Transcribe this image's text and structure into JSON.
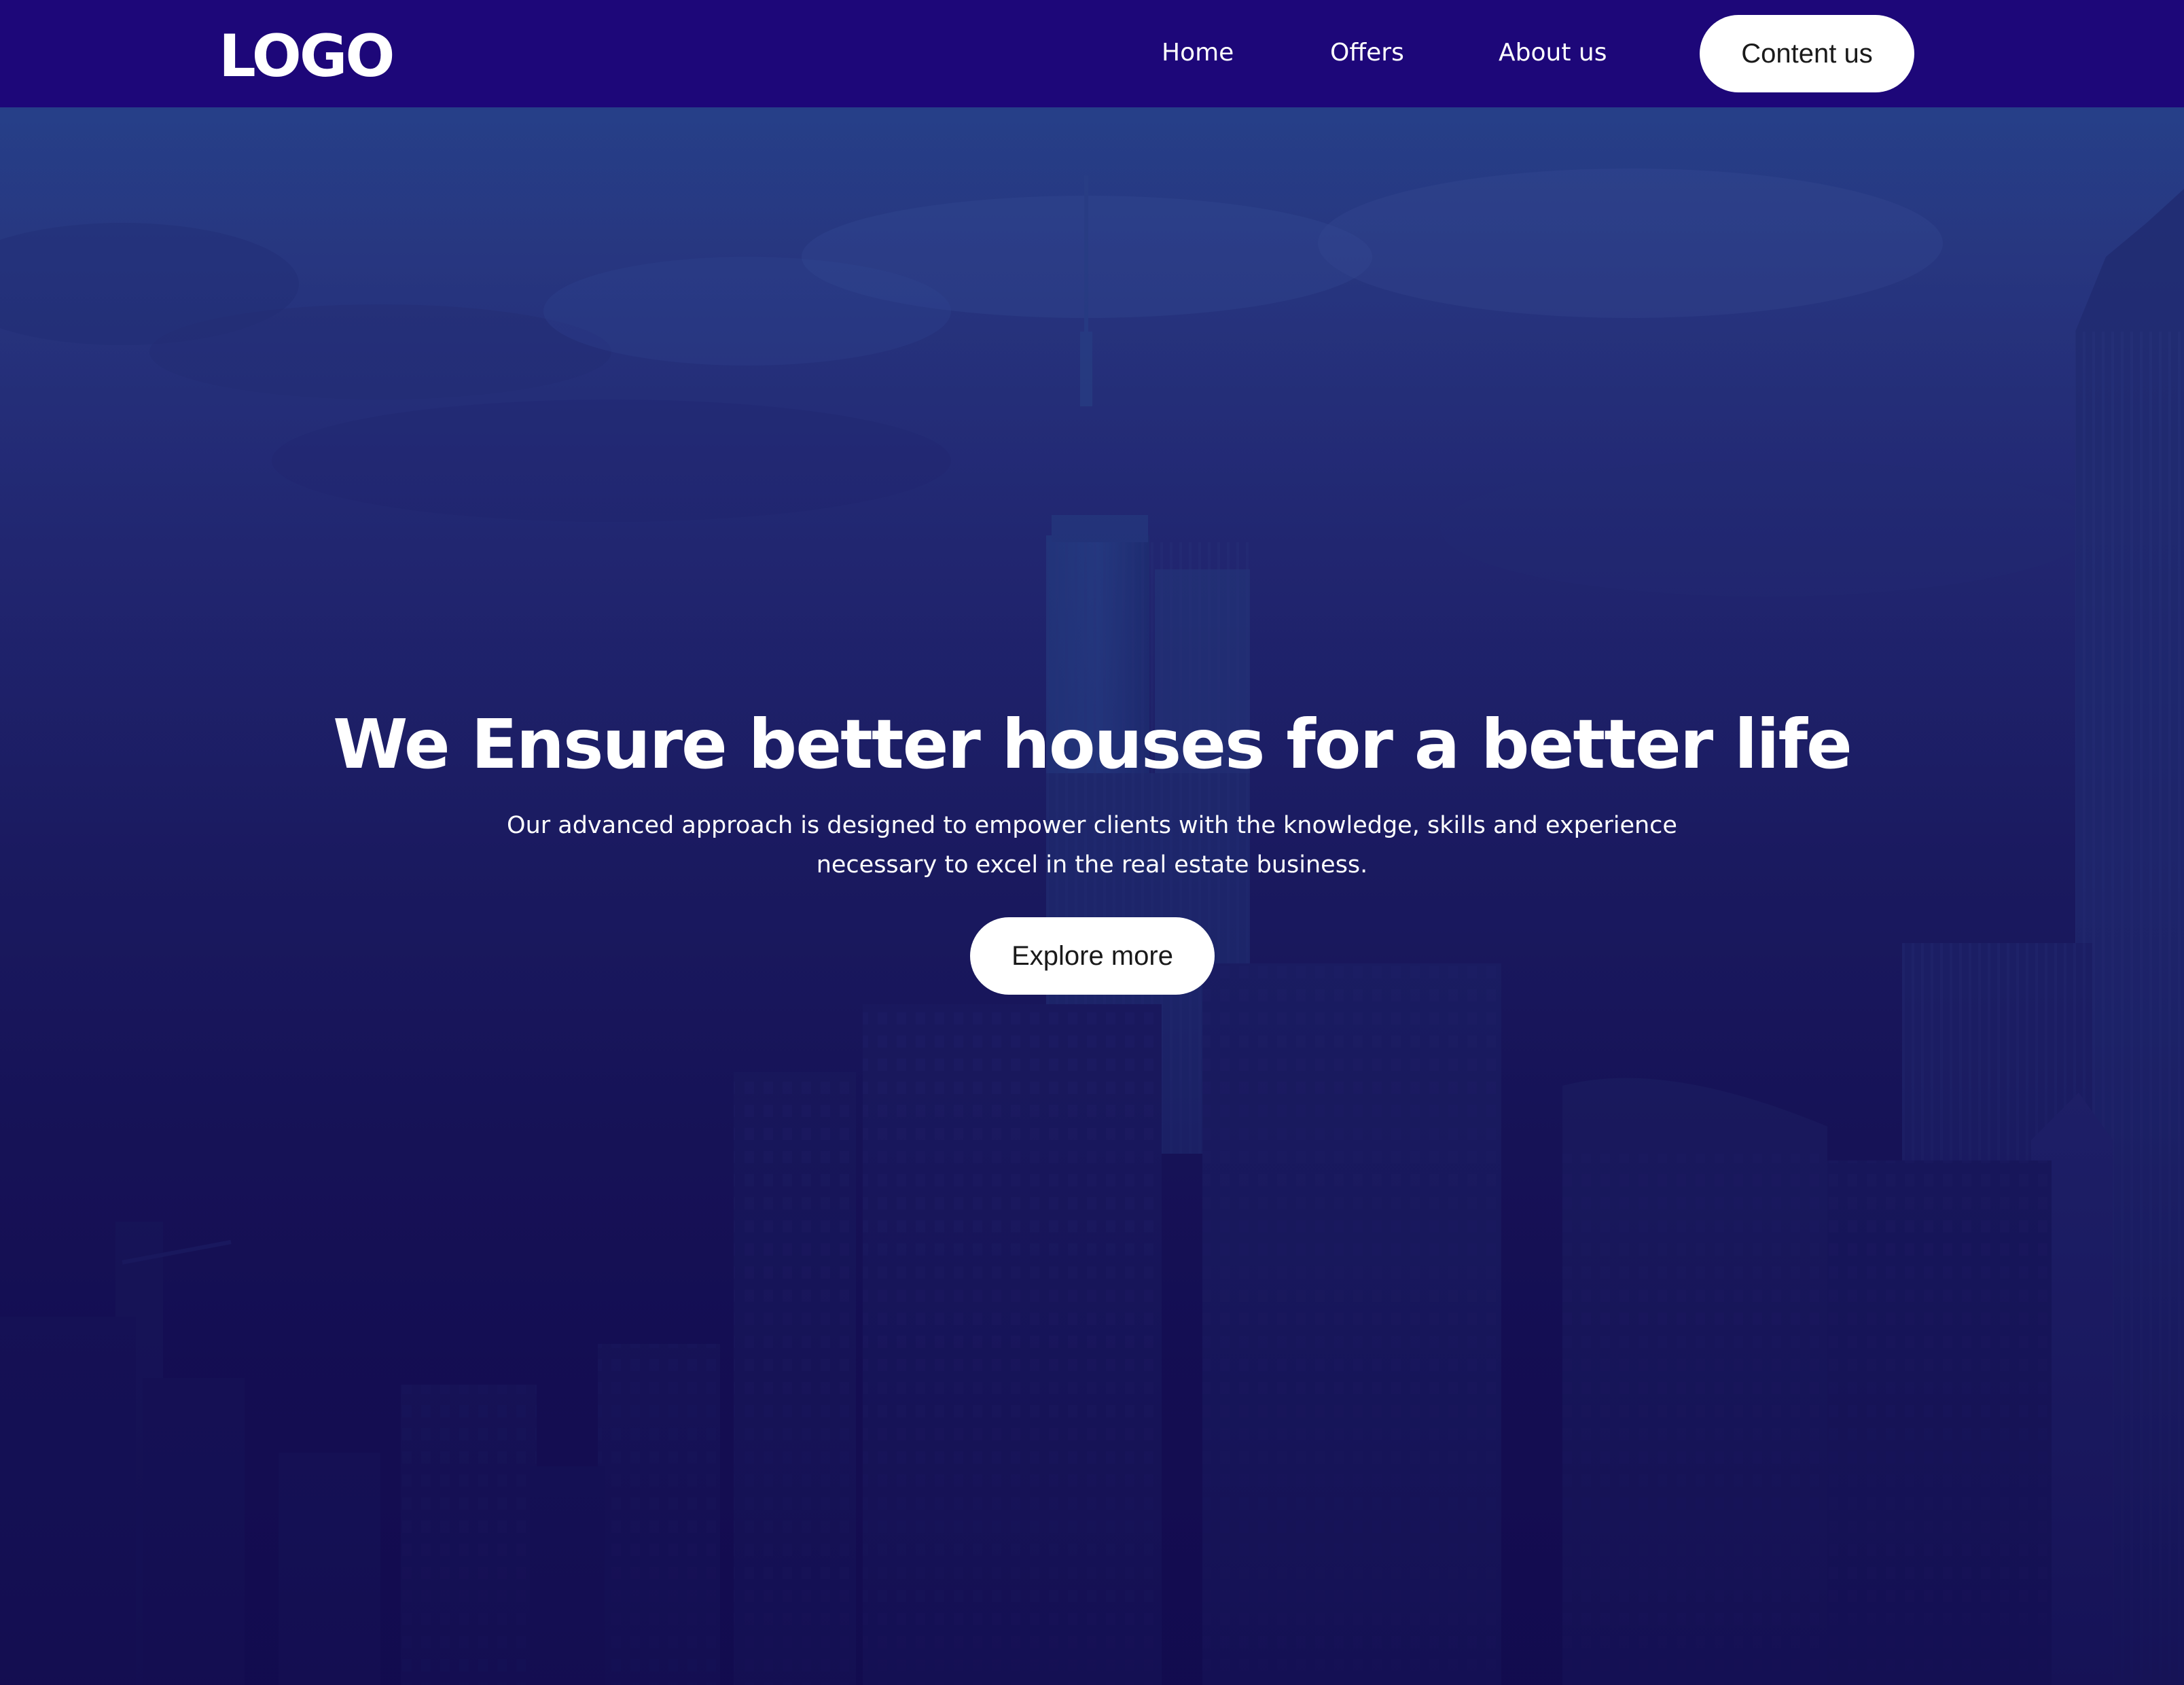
{
  "header": {
    "logo": "LOGO",
    "nav": {
      "home": "Home",
      "offers": "Offers",
      "about": "About us"
    },
    "cta_label": "Content us"
  },
  "hero": {
    "title": "We Ensure better houses for a better life",
    "subtitle": "Our advanced approach is designed to empower clients with the knowledge, skills and experience necessary to excel in the real estate business.",
    "cta_label": "Explore more",
    "background_image": "city-skyline-at-dusk"
  },
  "colors": {
    "header_bg": "#1d0779",
    "hero_overlay": "#1a1a5c",
    "button_bg": "#ffffff",
    "text_light": "#ffffff"
  }
}
